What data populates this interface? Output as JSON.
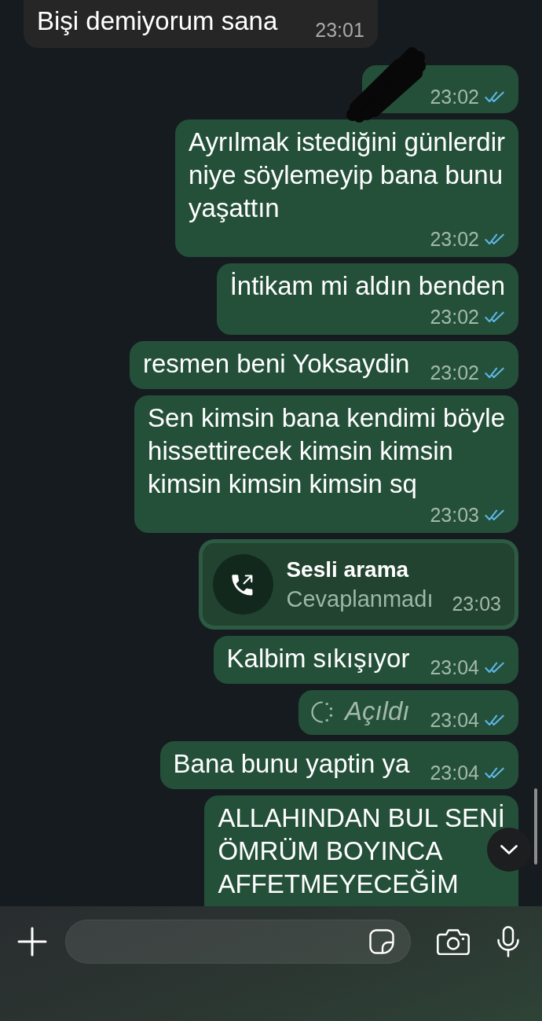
{
  "messages": [
    {
      "kind": "text",
      "outgoing": false,
      "lines": [
        "Bişi demiyorum sana"
      ],
      "time": "23:01"
    },
    {
      "kind": "redacted",
      "outgoing": true,
      "time": "23:02",
      "read": true
    },
    {
      "kind": "text",
      "outgoing": true,
      "lines": [
        "Ayrılmak istediğini günlerdir",
        "niye söylemeyip bana bunu",
        "yaşattın"
      ],
      "time": "23:02",
      "read": true
    },
    {
      "kind": "text",
      "outgoing": true,
      "lines": [
        "İntikam mi aldın benden"
      ],
      "time": "23:02",
      "read": true
    },
    {
      "kind": "text",
      "outgoing": true,
      "lines": [
        "resmen beni Yoksaydin"
      ],
      "time": "23:02",
      "read": true
    },
    {
      "kind": "text",
      "outgoing": true,
      "lines": [
        "Sen kimsin bana kendimi böyle",
        "hissettirecek kimsin kimsin",
        "kimsin kimsin kimsin sq"
      ],
      "time": "23:03",
      "read": true
    },
    {
      "kind": "call",
      "outgoing": true,
      "title": "Sesli arama",
      "subtitle": "Cevaplanmadı",
      "time": "23:03"
    },
    {
      "kind": "text",
      "outgoing": true,
      "lines": [
        "Kalbim sıkışıyor"
      ],
      "time": "23:04",
      "read": true
    },
    {
      "kind": "view_once",
      "outgoing": true,
      "text": "Açıldı",
      "time": "23:04",
      "read": true
    },
    {
      "kind": "text",
      "outgoing": true,
      "lines": [
        "Bana bunu yaptin ya"
      ],
      "time": "23:04",
      "read": true
    },
    {
      "kind": "text",
      "outgoing": true,
      "lines": [
        "ALLAHINDAN BUL SENİ",
        "ÖMRÜM BOYINCA",
        "AFFETMEYECEĞİM"
      ]
    }
  ]
}
